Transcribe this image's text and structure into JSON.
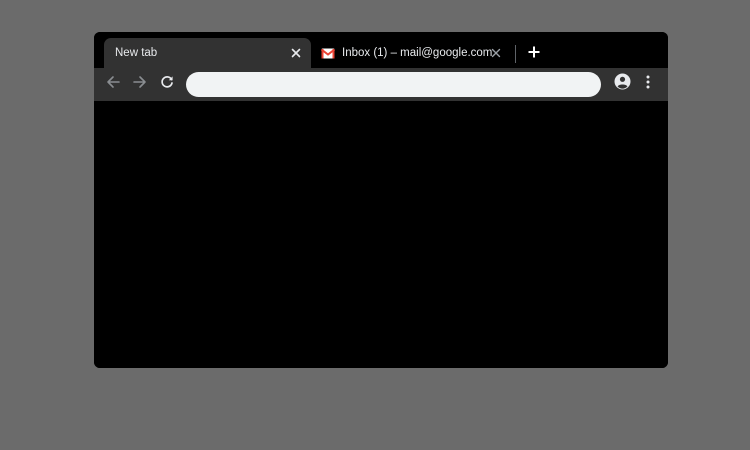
{
  "tabs": [
    {
      "title": "New tab",
      "active": true,
      "close_icon": "close-icon"
    },
    {
      "title": "Inbox (1) – mail@google.com",
      "active": false,
      "favicon": "gmail-icon",
      "close_icon": "close-icon"
    }
  ],
  "new_tab_icon": "plus-icon",
  "toolbar": {
    "back_icon": "arrow-left-icon",
    "forward_icon": "arrow-right-icon",
    "reload_icon": "reload-icon",
    "omnibox_value": "",
    "omnibox_placeholder": "",
    "profile_icon": "account-circle-icon",
    "menu_icon": "more-vert-icon"
  },
  "colors": {
    "desktop": "#6b6b6b",
    "frame": "#000000",
    "toolbar": "#323232",
    "omnibox": "#f1f3f4",
    "text": "#e8eaed",
    "gmail_red": "#ea4335"
  }
}
